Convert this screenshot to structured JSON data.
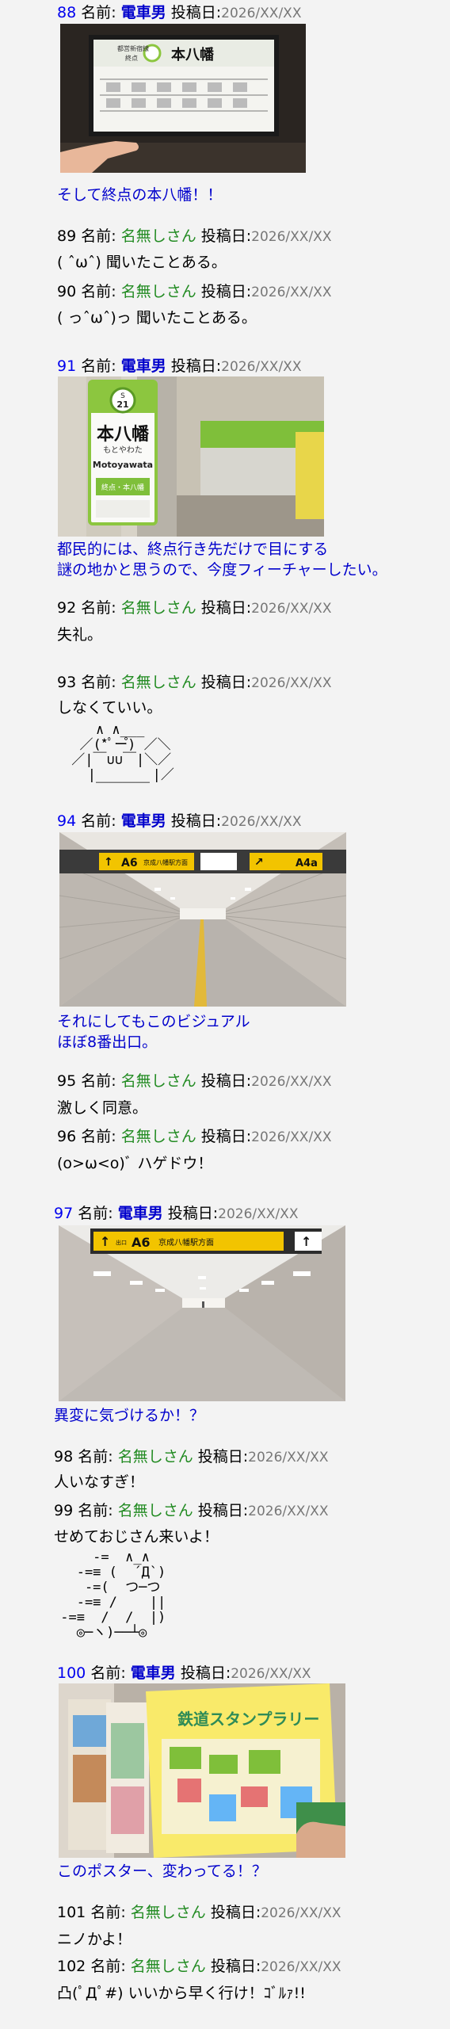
{
  "labels": {
    "name": "名前:",
    "date": "投稿日:"
  },
  "posters": {
    "op": "電車男",
    "anon": "名無しさん"
  },
  "date": "2026/XX/XX",
  "posts": [
    {
      "num": "88",
      "body": "そして終点の本八幡！！"
    },
    {
      "num": "89",
      "body": "( ˆωˆ) 聞いたことある。"
    },
    {
      "num": "90",
      "body": "( っˆωˆ)っ 聞いたことある。"
    },
    {
      "num": "91",
      "body": "都民的には、終点行き先だけで目にする\n謎の地かと思うので、今度フィーチャーしたい。"
    },
    {
      "num": "92",
      "body": "失礼。"
    },
    {
      "num": "93",
      "body": "しなくていい。",
      "aa": "    ∧ ∧___\n  ／(*ﾟー゚) ／＼\n ／|￣∪∪￣|＼／\n   |       |／\n    ￣￣￣￣"
    },
    {
      "num": "94",
      "body": "それにしてもこのビジュアル\nほぼ8番出口。"
    },
    {
      "num": "95",
      "body": "激しく同意。"
    },
    {
      "num": "96",
      "body": "(o>ω<o)ﾞ ハゲドウ！"
    },
    {
      "num": "97",
      "body": "異変に気づけるか！？"
    },
    {
      "num": "98",
      "body": "人いなすぎ！"
    },
    {
      "num": "99",
      "body": "せめておじさん来いよ！",
      "aa": "     -=  ∧_∧\n   -=≡ (  ´Д`)\n    -=(  つ─つ\n   -=≡ /    ||\n -=≡  /  /  |)\n   ◎─ヽ)──┴◎"
    },
    {
      "num": "100",
      "body": "このポスター、変わってる！？"
    },
    {
      "num": "101",
      "body": "ニノかよ！"
    },
    {
      "num": "102",
      "body": "凸(ﾟДﾟ#) いいから早く行け！ｺﾞﾙｧ!!"
    }
  ],
  "photos": {
    "p88": {
      "line": "都営新宿線",
      "station": "本八幡",
      "terminus": "終点"
    },
    "p91": {
      "code_line": "S",
      "code_num": "21",
      "name": "本八幡",
      "kana": "もとやわた",
      "roman": "Motoyawata",
      "terminus": "終点・本八幡"
    },
    "p94": {
      "exit": "A6",
      "dir": "京成八幡駅方面",
      "exit2": "A4a"
    },
    "p97": {
      "exit_small": "出口",
      "exit": "A6",
      "dir": "京成八幡駅方面"
    },
    "p100": {
      "title": "鉄道スタンプラリー"
    }
  },
  "colors": {
    "op": "#0000cc",
    "anon": "#228b22",
    "link": "#0000ee",
    "date": "#777777",
    "sign_green": "#8cc63f"
  }
}
